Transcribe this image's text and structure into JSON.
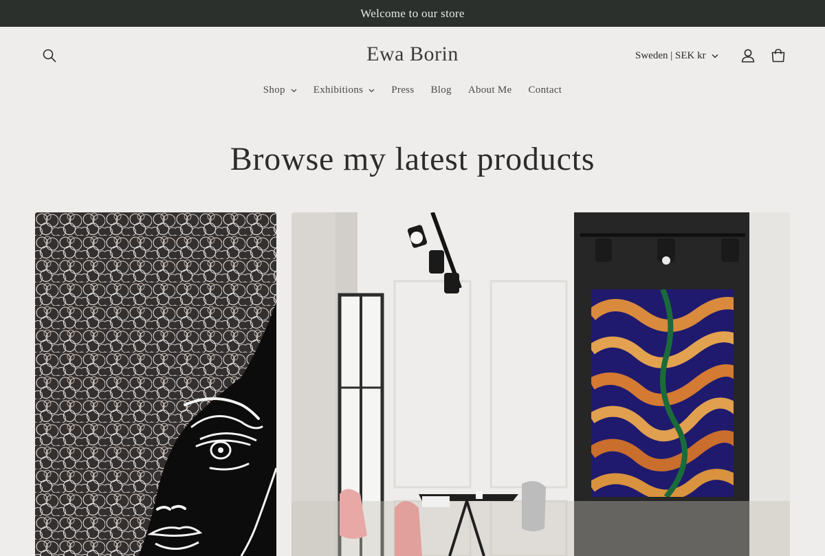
{
  "announcement": {
    "text": "Welcome to our store"
  },
  "header": {
    "logo": "Ewa Borin",
    "country_selector": "Sweden | SEK kr",
    "icons": {
      "search": "search-icon",
      "account": "account-icon",
      "cart": "cart-icon"
    }
  },
  "nav": {
    "items": [
      {
        "label": "Shop",
        "has_dropdown": true
      },
      {
        "label": "Exhibitions",
        "has_dropdown": true
      },
      {
        "label": "Press",
        "has_dropdown": false
      },
      {
        "label": "Blog",
        "has_dropdown": false
      },
      {
        "label": "About Me",
        "has_dropdown": false
      },
      {
        "label": "Contact",
        "has_dropdown": false
      }
    ]
  },
  "main": {
    "heading": "Browse my latest products",
    "products": [
      {
        "image": "line-art-portrait-painting"
      },
      {
        "image": "abstract-wave-painting-in-gallery-room"
      }
    ]
  },
  "colors": {
    "announcement_bg": "#2b302c",
    "page_bg": "#eeedeb",
    "text": "#2a2a2a"
  }
}
